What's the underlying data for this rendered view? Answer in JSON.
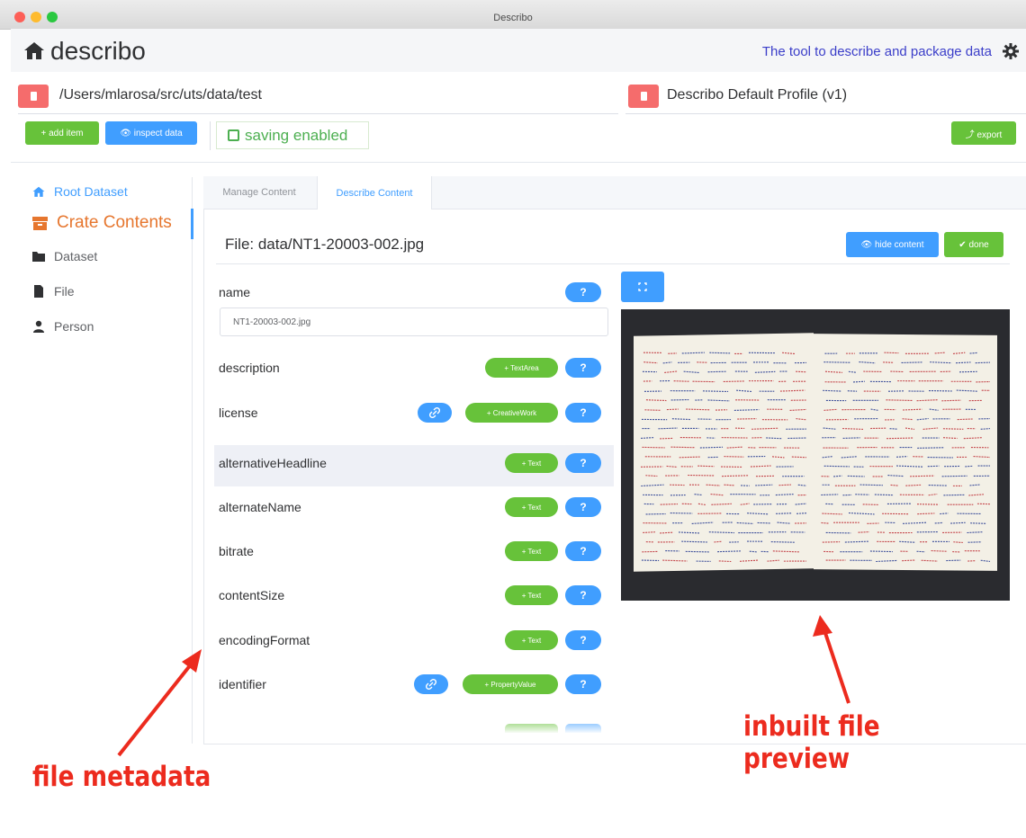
{
  "window": {
    "title": "Describo"
  },
  "header": {
    "brand": "describo",
    "tagline": "The tool to describe and package data"
  },
  "path_bar": {
    "path": "/Users/mlarosa/src/uts/data/test"
  },
  "profile_bar": {
    "profile": "Describo Default Profile (v1)"
  },
  "toolbar": {
    "add_item": "+ add item",
    "inspect_data": "👁 inspect data",
    "saving": "saving enabled",
    "export": "⤴ export"
  },
  "sidebar": {
    "root": "Root Dataset",
    "crate_contents": "Crate Contents",
    "items": [
      "Dataset",
      "File",
      "Person"
    ]
  },
  "tabs": {
    "manage": "Manage Content",
    "describe": "Describe Content"
  },
  "file": {
    "title": "File: data/NT1-20003-002.jpg",
    "hide_content": "👁 hide content",
    "done": "✔ done"
  },
  "properties": {
    "name": {
      "label": "name",
      "value": "NT1-20003-002.jpg"
    },
    "description": {
      "label": "description",
      "add": "+ TextArea"
    },
    "license": {
      "label": "license",
      "add": "+ CreativeWork"
    },
    "alternativeHeadline": {
      "label": "alternativeHeadline",
      "add": "+ Text"
    },
    "alternateName": {
      "label": "alternateName",
      "add": "+ Text"
    },
    "bitrate": {
      "label": "bitrate",
      "add": "+ Text"
    },
    "contentSize": {
      "label": "contentSize",
      "add": "+ Text"
    },
    "encodingFormat": {
      "label": "encodingFormat",
      "add": "+ Text"
    },
    "identifier": {
      "label": "identifier",
      "add": "+ PropertyValue"
    },
    "help": "?"
  },
  "annotations": {
    "file_metadata": "file metadata",
    "inbuilt_preview": "inbuilt file preview"
  },
  "colors": {
    "green": "#67c23a",
    "blue": "#409eff",
    "red": "#f56c6c",
    "annotation": "#ec2b1e",
    "crate": "#e6762e"
  }
}
